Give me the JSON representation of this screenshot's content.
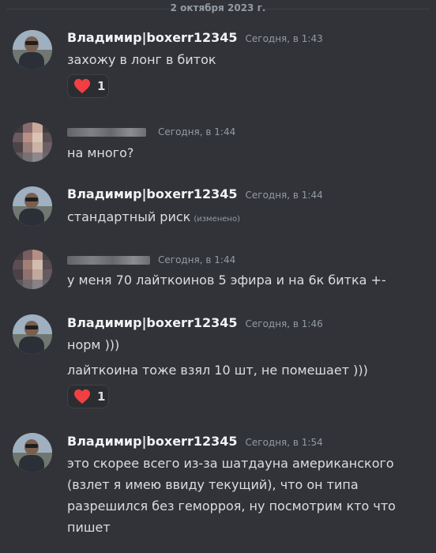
{
  "date_divider": "2 октября 2023 г.",
  "colors": {
    "background": "#313338",
    "heart": "#f23f43",
    "username": "#f2f3f5",
    "timestamp": "#949ba4"
  },
  "messages": [
    {
      "author": "Владимир|boxerr12345",
      "time": "Сегодня, в 1:43",
      "text": "захожу в лонг в биток",
      "reaction": {
        "emoji": "heart",
        "count": "1"
      }
    },
    {
      "author": "",
      "time": "Сегодня, в 1:44",
      "text": "на много?"
    },
    {
      "author": "Владимир|boxerr12345",
      "time": "Сегодня, в 1:44",
      "text": "стандартный риск",
      "edited": "(изменено)"
    },
    {
      "author": "",
      "time": "Сегодня, в 1:44",
      "text": "у меня 70 лайткоинов 5 эфира и на 6к битка +-"
    },
    {
      "author": "Владимир|boxerr12345",
      "time": "Сегодня, в 1:46",
      "text": "норм )))",
      "text2": "лайткоина тоже взял 10 шт, не помешает )))",
      "reaction": {
        "emoji": "heart",
        "count": "1"
      }
    },
    {
      "author": "Владимир|boxerr12345",
      "time": "Сегодня, в 1:54",
      "text": "это скорее всего из-за шатдауна американского (взлет я имею ввиду текущий), что он типа разрешился без геморроя, ну посмотрим кто что пишет"
    }
  ]
}
